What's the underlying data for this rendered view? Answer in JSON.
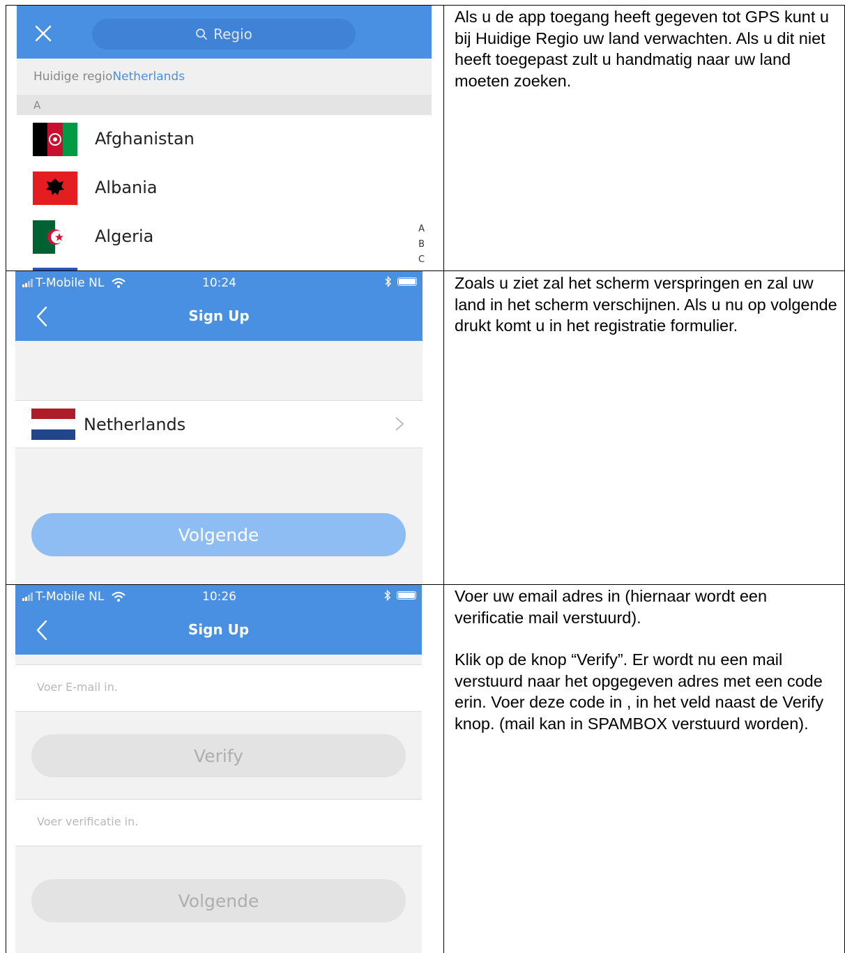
{
  "rows": [
    {
      "screen": {
        "search_placeholder": "Regio",
        "current_region_label": "Huidige regio",
        "current_region_value": "Netherlands",
        "section_letter": "A",
        "countries": [
          {
            "name": "Afghanistan",
            "flag": "afghanistan-flag"
          },
          {
            "name": "Albania",
            "flag": "albania-flag"
          },
          {
            "name": "Algeria",
            "flag": "algeria-flag"
          }
        ],
        "index_letters": [
          "A",
          "B",
          "C"
        ],
        "accent_color": "#4a90e2"
      },
      "description": [
        "Als u de app toegang heeft gegeven tot GPS kunt u bij Huidige Regio uw land verwachten. Als u dit niet heeft toegepast zult u handmatig naar uw land moeten zoeken."
      ]
    },
    {
      "screen": {
        "carrier": "T-Mobile NL",
        "time": "10:24",
        "title": "Sign Up",
        "country": "Netherlands",
        "next_button": "Volgende",
        "next_button_color": "#8dbdf2"
      },
      "description": [
        "Zoals u ziet zal het scherm verspringen en zal uw land in het scherm verschijnen. Als u nu op volgende drukt komt u in het registratie formulier."
      ]
    },
    {
      "screen": {
        "carrier": "T-Mobile NL",
        "time": "10:26",
        "title": "Sign Up",
        "email_placeholder": "Voer E-mail in.",
        "verify_button": "Verify",
        "verification_placeholder": "Voer verificatie in.",
        "next_button": "Volgende",
        "disabled_button_color": "#e3e3e3"
      },
      "description": [
        "Voer uw email adres in (hiernaar wordt een verificatie mail verstuurd).",
        "Klik op de knop “Verify”. Er wordt nu een mail verstuurd naar het opgegeven adres met een code erin. Voer deze code in , in het veld naast de Verify knop. (mail kan in SPAMBOX verstuurd worden)."
      ]
    }
  ]
}
